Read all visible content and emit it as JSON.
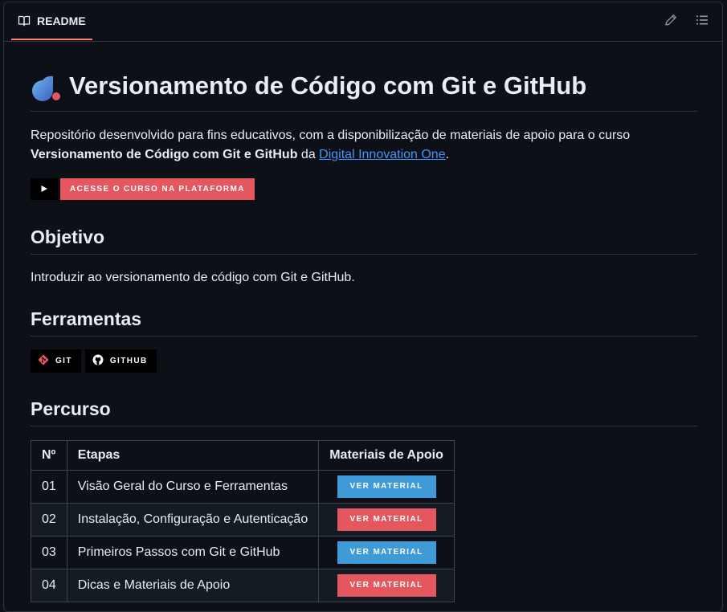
{
  "header": {
    "tab_label": "README",
    "tab_icon": "book-icon",
    "edit_icon": "pencil-icon",
    "outline_icon": "list-icon"
  },
  "readme": {
    "title": "Versionamento de Código com Git e GitHub",
    "intro_prefix": "Repositório desenvolvido para fins educativos, com a disponibilização de materiais de apoio para o curso ",
    "intro_bold": "Versionamento de Código com Git e GitHub",
    "intro_middle": " da ",
    "intro_link": "Digital Innovation One",
    "intro_suffix": ".",
    "cta_label": "ACESSE O CURSO NA PLATAFORMA",
    "objective_heading": "Objetivo",
    "objective_text": "Introduzir ao versionamento de código com Git e GitHub.",
    "tools_heading": "Ferramentas",
    "tools": [
      {
        "label": "GIT",
        "icon": "git-icon"
      },
      {
        "label": "GITHUB",
        "icon": "github-icon"
      }
    ],
    "path_heading": "Percurso",
    "table": {
      "headers": [
        "Nº",
        "Etapas",
        "Materiais de Apoio"
      ],
      "rows": [
        {
          "num": "01",
          "step": "Visão Geral do Curso e Ferramentas",
          "button": "VER MATERIAL",
          "color": "#3f9ad8"
        },
        {
          "num": "02",
          "step": "Instalação, Configuração e Autenticação",
          "button": "VER MATERIAL",
          "color": "#e4575f"
        },
        {
          "num": "03",
          "step": "Primeiros Passos com Git e GitHub",
          "button": "VER MATERIAL",
          "color": "#3f9ad8"
        },
        {
          "num": "04",
          "step": "Dicas e Materiais de Apoio",
          "button": "VER MATERIAL",
          "color": "#e4575f"
        }
      ]
    }
  },
  "colors": {
    "background": "#0d1117",
    "border": "#30363d",
    "link": "#4493f8",
    "accent_red": "#e4575f",
    "accent_blue": "#3f9ad8",
    "tab_underline": "#f78166"
  }
}
